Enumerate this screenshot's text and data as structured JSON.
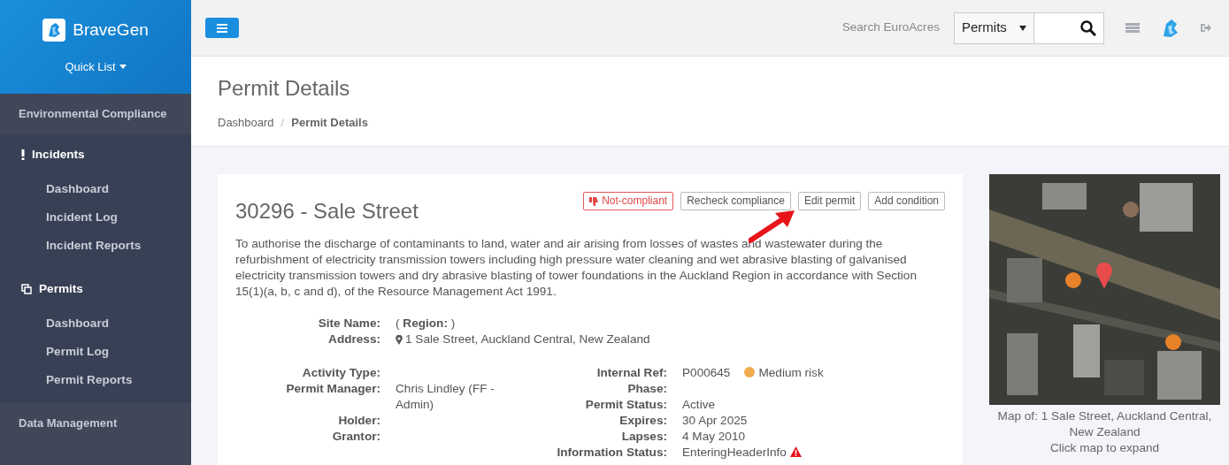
{
  "sidebar": {
    "logo": "BraveGen",
    "quick_list": "Quick List",
    "nav": [
      {
        "label": "Environmental Compliance",
        "kind": "category"
      },
      {
        "label": "Incidents",
        "kind": "group",
        "expanded": true,
        "children": [
          {
            "label": "Dashboard"
          },
          {
            "label": "Incident Log"
          },
          {
            "label": "Incident Reports"
          }
        ]
      },
      {
        "label": "Permits",
        "kind": "group",
        "expanded": true,
        "children": [
          {
            "label": "Dashboard"
          },
          {
            "label": "Permit Log"
          },
          {
            "label": "Permit Reports"
          }
        ]
      },
      {
        "label": "Data Management",
        "kind": "category"
      }
    ]
  },
  "topbar": {
    "search_label": "Search EuroAcres",
    "search_scope": "Permits"
  },
  "page": {
    "title": "Permit Details",
    "breadcrumb_separator": "/",
    "breadcrumb": [
      {
        "label": "Dashboard",
        "selected": false
      },
      {
        "label": "Permit Details",
        "selected": true
      }
    ]
  },
  "permit": {
    "title": "30296 - Sale Street",
    "buttons": [
      {
        "label": "Not-compliant",
        "kind": "danger"
      },
      {
        "label": "Recheck compliance",
        "kind": "default"
      },
      {
        "label": "Edit permit",
        "kind": "default"
      },
      {
        "label": "Add condition",
        "kind": "default"
      }
    ],
    "description": "To authorise the discharge of contaminants to land, water and air arising from losses of wastes and wastewater during the refurbishment of electricity transmission towers including high pressure water cleaning and wet abrasive blasting of galvanised electricity transmission towers and dry abrasive blasting of tower foundations in the Auckland Region in accordance with Section 15(1)(a, b, c and d), of the Resource Management Act 1991.",
    "site_fields": [
      {
        "label": "Site Name:",
        "value": "( **Region:** )"
      },
      {
        "label": "Address:",
        "value": "1 Sale Street, Auckland Central, New Zealand",
        "kind": "address"
      }
    ],
    "left_fields": [
      {
        "label": "Activity Type:"
      },
      {
        "label": "Permit Manager:",
        "value": "Chris Lindley (FF - Admin)"
      },
      {
        "label": "Holder:"
      },
      {
        "label": "Grantor:"
      }
    ],
    "right_fields": [
      {
        "label": "Internal Ref:",
        "value": "P000645",
        "risk": {
          "label": "Medium risk",
          "color": "#f0ad4e"
        }
      },
      {
        "label": "Phase:"
      },
      {
        "label": "Permit Status:",
        "value": "Active"
      },
      {
        "label": "Expires:",
        "value": "30 Apr 2025"
      },
      {
        "label": "Lapses:",
        "value": "4 May 2010"
      },
      {
        "label": "Information Status:",
        "value": "EnteringHeaderInfo",
        "warning": true
      }
    ]
  },
  "map": {
    "caption": "Map of: 1 Sale Street, Auckland Central, New Zealand",
    "hint": "Click map to expand"
  }
}
